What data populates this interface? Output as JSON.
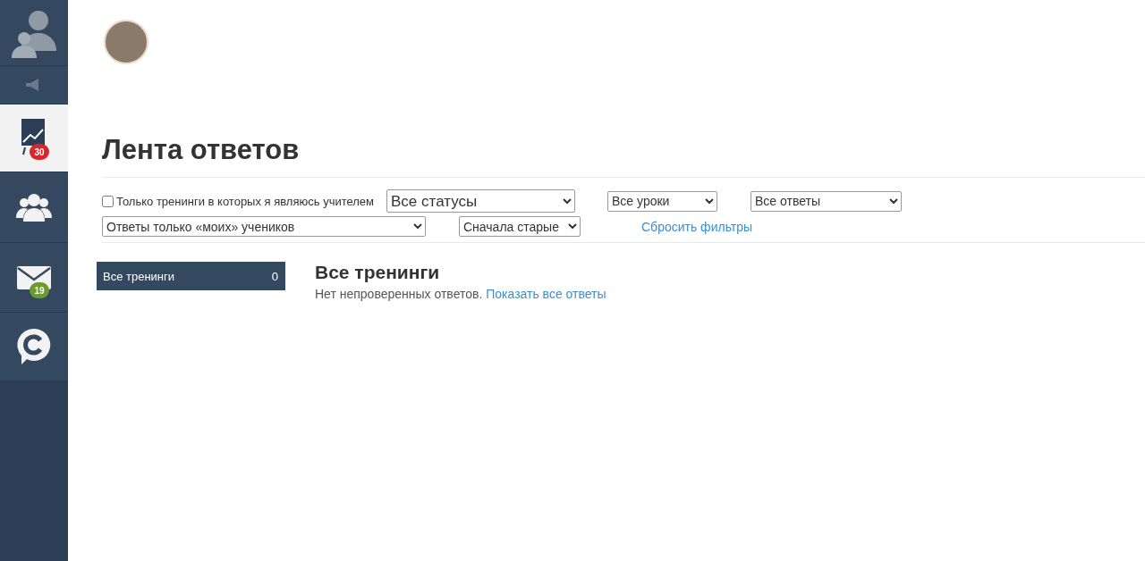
{
  "sidebar": {
    "items": [
      {
        "kind": "profile",
        "selected": false
      },
      {
        "kind": "speaker",
        "selected": false
      },
      {
        "kind": "chart",
        "selected": true,
        "badge": "30",
        "color": "#d9262c"
      },
      {
        "kind": "group",
        "selected": false
      },
      {
        "kind": "mail",
        "selected": false,
        "badge": "19",
        "color": "#6b9a2e"
      },
      {
        "kind": "chat",
        "selected": false
      }
    ]
  },
  "page": {
    "title": "Лента ответов"
  },
  "filters": {
    "teacher_only": {
      "label": "Только тренинги в которых я являюсь учителем",
      "checked": false
    },
    "status": "Все статусы",
    "lessons": "Все уроки",
    "answers": "Все ответы",
    "students": "Ответы только «моих» учеников",
    "sort": "Сначала старые",
    "reset": "Сбросить фильтры"
  },
  "trainings": [
    {
      "label": "Все тренинги",
      "count": "0",
      "selected": true
    }
  ],
  "content": {
    "heading": "Все тренинги",
    "message": "Нет непроверенных ответов.",
    "link": "Показать все ответы"
  }
}
